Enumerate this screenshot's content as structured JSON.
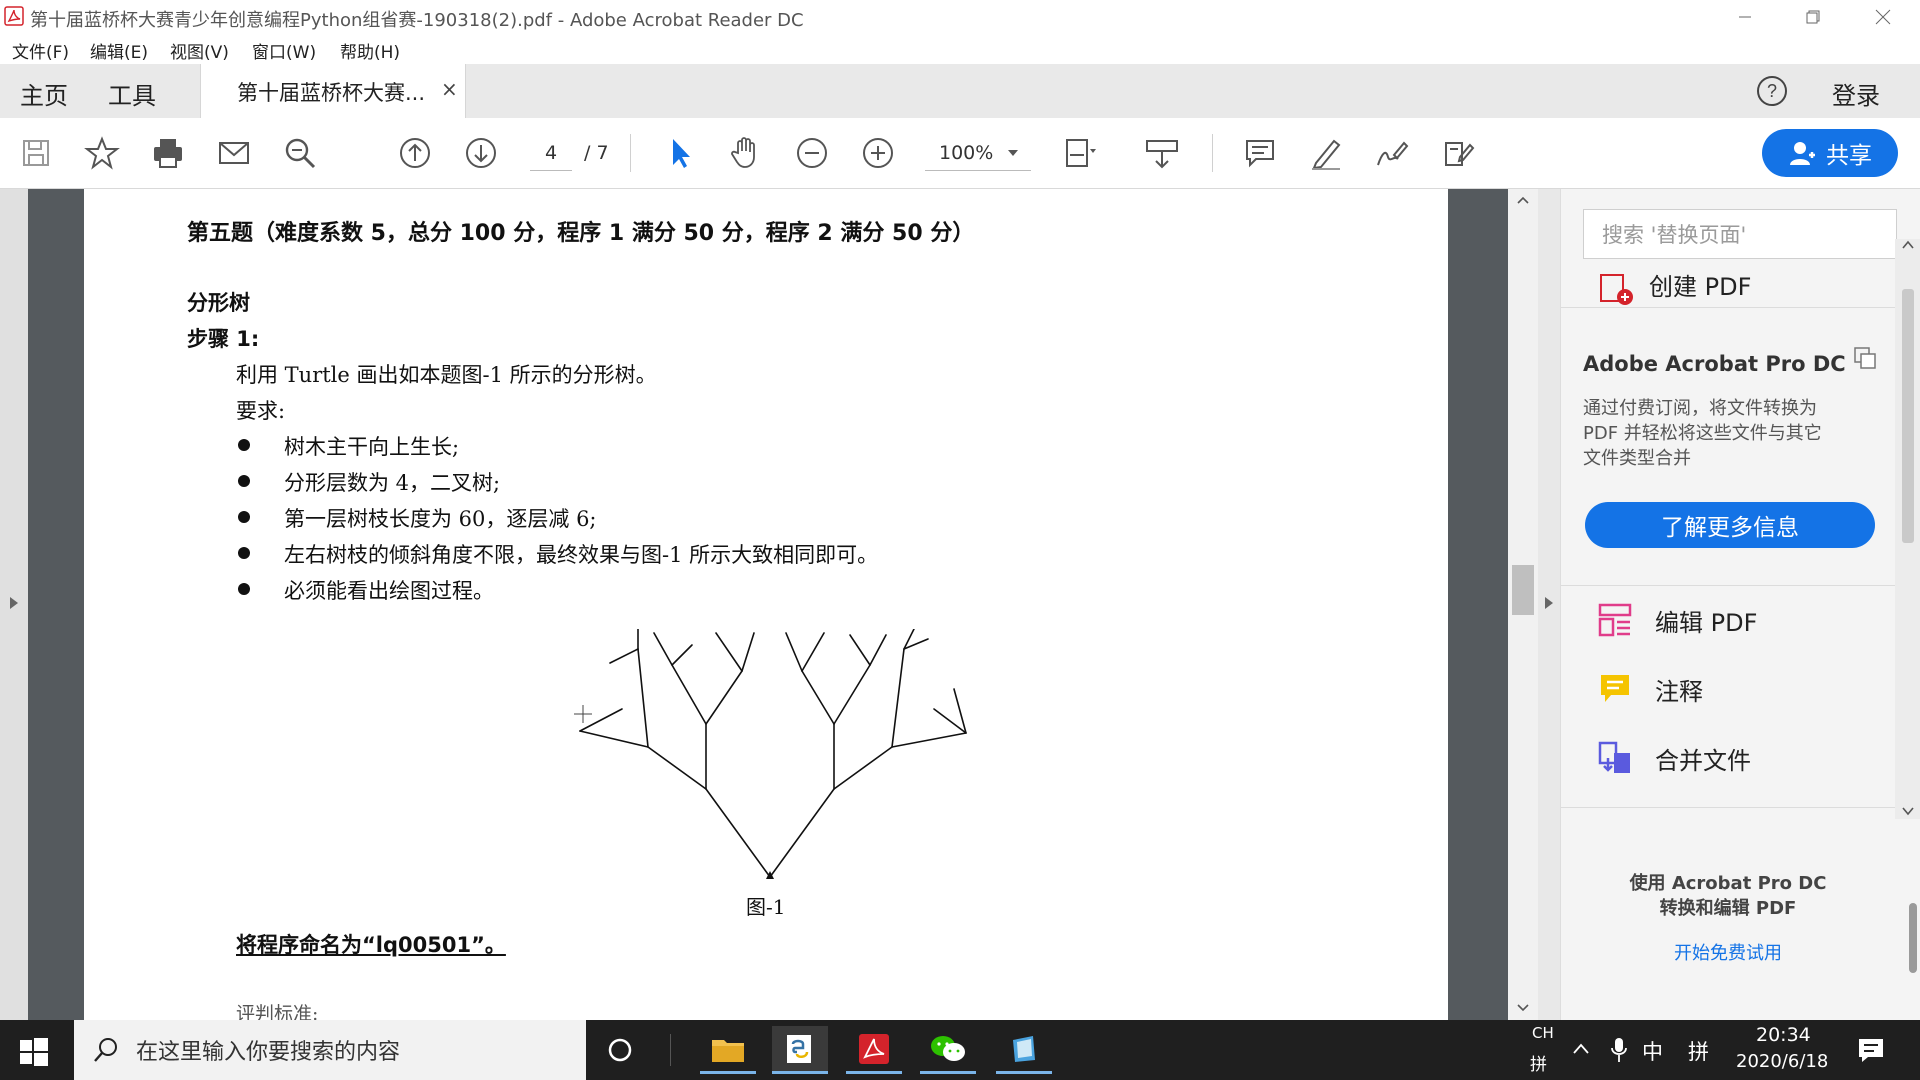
{
  "window": {
    "title": "第十届蓝桥杯大赛青少年创意编程Python组省赛-190318(2).pdf - Adobe Acrobat Reader DC"
  },
  "menu": [
    "文件(F)",
    "编辑(E)",
    "视图(V)",
    "窗口(W)",
    "帮助(H)"
  ],
  "tabs": {
    "home": "主页",
    "tools": "工具",
    "document": "第十届蓝桥杯大赛...",
    "close": "×",
    "login": "登录"
  },
  "toolbar": {
    "page_current": "4",
    "page_total": "/ 7",
    "zoom": "100%",
    "share_label": "共享"
  },
  "document": {
    "heading": "第五题（难度系数 5，总分 100 分，程序 1 满分 50 分，程序 2 满分 50 分）",
    "subtitle": "分形树",
    "step": "步骤 1:",
    "instruction": "利用 Turtle 画出如本题图-1 所示的分形树。",
    "requirements_label": "要求:",
    "bullets": [
      "树木主干向上生长;",
      "分形层数为 4，二叉树;",
      "第一层树枝长度为 60，逐层减 6;",
      "左右树枝的倾斜角度不限，最终效果与图-1 所示大致相同即可。",
      "必须能看出绘图过程。"
    ],
    "figure_caption": "图-1",
    "naming": "将程序命名为“lq00501”。",
    "next_section": "评判标准:"
  },
  "right_panel": {
    "search_placeholder": "搜索 '替换页面'",
    "create_pdf": "创建 PDF",
    "promo_title": "Adobe Acrobat Pro DC",
    "promo_text": [
      "通过付费订阅，将文件转换为",
      "PDF 并轻松将这些文件与其它",
      "文件类型合并"
    ],
    "learn_more": "了解更多信息",
    "tools": [
      "编辑 PDF",
      "注释",
      "合并文件"
    ],
    "footer_text": [
      "使用 Acrobat Pro DC",
      "转换和编辑 PDF"
    ],
    "trial_link": "开始免费试用"
  },
  "taskbar": {
    "search_placeholder": "在这里输入你要搜索的内容",
    "ime_top": "CH",
    "ime_bottom": "拼",
    "lang": "中",
    "ime_mode": "拼",
    "time": "20:34",
    "date": "2020/6/18"
  },
  "colors": {
    "accent": "#1473e6",
    "doc_bg": "#555a5e",
    "taskbar": "#1f1f1f"
  }
}
